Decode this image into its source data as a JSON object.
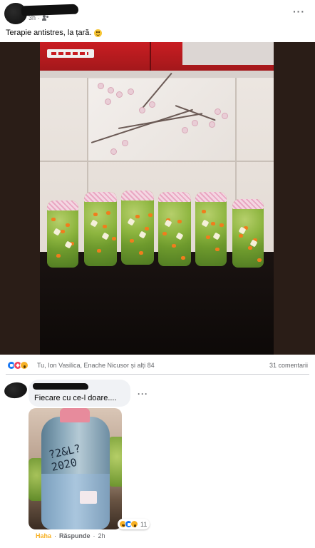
{
  "post": {
    "time": "3h",
    "audience_icon": "friends-icon",
    "text": "Terapie antistres, la țară.",
    "text_emoji": "smile-emoji",
    "more_icon": "more-options-icon"
  },
  "reactions": {
    "icons": [
      "like-icon",
      "love-icon",
      "wow-icon"
    ],
    "summary": "Tu, Ion Vasilica, Enache Nicusor și alți 84",
    "comments_count": "31 comentarii"
  },
  "comment": {
    "text": "Fiecare cu ce-l doare....",
    "more_icon": "more-options-icon",
    "photo_scrawl_line1": "?2&L?",
    "photo_scrawl_line2": "2020",
    "reaction_icons": [
      "haha-icon",
      "like-icon",
      "wow-icon"
    ],
    "reaction_count": "11",
    "actions": {
      "haha": "Haha",
      "separator": "·",
      "reply": "Răspunde",
      "time": "2h"
    }
  },
  "colors": {
    "accent": "#1877f2",
    "love": "#f33e58",
    "haha": "#f7b125",
    "secondary_text": "#65676b",
    "comment_bubble": "#f0f2f5"
  }
}
